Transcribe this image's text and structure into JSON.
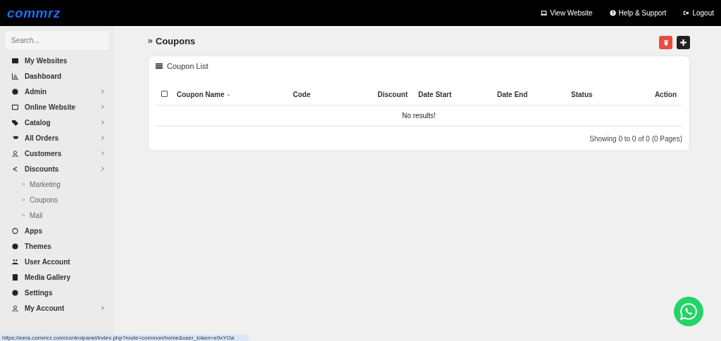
{
  "logo": "commrz",
  "header_links": [
    {
      "label": "View Website"
    },
    {
      "label": "Help & Support"
    },
    {
      "label": "Logout"
    }
  ],
  "sidebar": {
    "search": {
      "placeholder": "Search..."
    },
    "items": [
      {
        "label": "My Websites",
        "has_submenu": false
      },
      {
        "label": "Dashboard",
        "has_submenu": false
      },
      {
        "label": "Admin",
        "has_submenu": true
      },
      {
        "label": "Online Website",
        "has_submenu": true
      },
      {
        "label": "Catalog",
        "has_submenu": true
      },
      {
        "label": "All Orders",
        "has_submenu": true
      },
      {
        "label": "Customers",
        "has_submenu": true
      },
      {
        "label": "Discounts",
        "has_submenu": true,
        "children": [
          {
            "label": "Marketing"
          },
          {
            "label": "Coupons"
          },
          {
            "label": "Mail"
          }
        ]
      },
      {
        "label": "Apps",
        "has_submenu": false
      },
      {
        "label": "Themes",
        "has_submenu": false
      },
      {
        "label": "User Account",
        "has_submenu": false
      },
      {
        "label": "Media Gallery",
        "has_submenu": false
      },
      {
        "label": "Settings",
        "has_submenu": false
      },
      {
        "label": "My Account",
        "has_submenu": true
      }
    ]
  },
  "page_title": "Coupons",
  "card": {
    "title": "Coupon List",
    "select_all": {
      "checked": false
    },
    "columns": [
      {
        "label": "Coupon Name",
        "sorted": true
      },
      {
        "label": "Code",
        "sorted": false
      },
      {
        "label": "Discount",
        "sorted": false
      },
      {
        "label": "Date Start",
        "sorted": false
      },
      {
        "label": "Date End",
        "sorted": false
      },
      {
        "label": "Status",
        "sorted": false
      },
      {
        "label": "Action",
        "sorted": false
      }
    ],
    "empty_message": "No results!",
    "pagination_summary": "Showing 0 to 0 of 0 (0 Pages)"
  },
  "status_url": "https://eera.commrz.com/controlpanel/index.php?route=common/home&user_token=e9xYOa"
}
